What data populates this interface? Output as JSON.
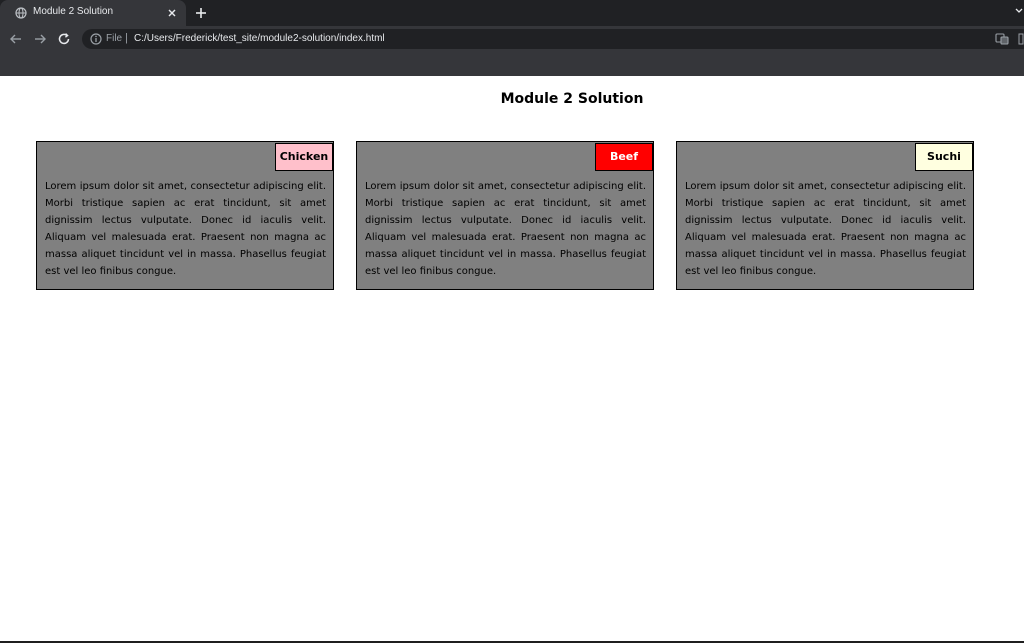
{
  "browser": {
    "tab_title": "Module 2 Solution",
    "scheme_label": "File",
    "url_separator": "|",
    "url": "C:/Users/Frederick/test_site/module2-solution/index.html"
  },
  "page": {
    "title": "Module 2 Solution",
    "cards": [
      {
        "label": "Chicken",
        "label_bg": "#ffc0cb",
        "label_color": "#000000",
        "body": "Lorem ipsum dolor sit amet, consectetur adipiscing elit. Morbi tristique sapien ac erat tincidunt, sit amet dignissim lectus vulputate. Donec id iaculis velit. Aliquam vel malesuada erat. Praesent non magna ac massa aliquet tincidunt vel in massa. Phasellus feugiat est vel leo finibus congue."
      },
      {
        "label": "Beef",
        "label_bg": "#ff0000",
        "label_color": "#ffffff",
        "body": "Lorem ipsum dolor sit amet, consectetur adipiscing elit. Morbi tristique sapien ac erat tincidunt, sit amet dignissim lectus vulputate. Donec id iaculis velit. Aliquam vel malesuada erat. Praesent non magna ac massa aliquet tincidunt vel in massa. Phasellus feugiat est vel leo finibus congue."
      },
      {
        "label": "Suchi",
        "label_bg": "#ffffe0",
        "label_color": "#000000",
        "body": "Lorem ipsum dolor sit amet, consectetur adipiscing elit. Morbi tristique sapien ac erat tincidunt, sit amet dignissim lectus vulputate. Donec id iaculis velit. Aliquam vel malesuada erat. Praesent non magna ac massa aliquet tincidunt vel in massa. Phasellus feugiat est vel leo finibus congue."
      }
    ],
    "card_bg": "#808080"
  },
  "icons": {
    "favicon": "globe-icon",
    "tab_close": "close-icon",
    "new_tab": "plus-icon",
    "back": "arrow-left-icon",
    "forward": "arrow-right-icon",
    "reload": "reload-icon",
    "site_info": "info-icon",
    "translate": "translate-icon",
    "tab_search": "chevron-down-icon"
  }
}
